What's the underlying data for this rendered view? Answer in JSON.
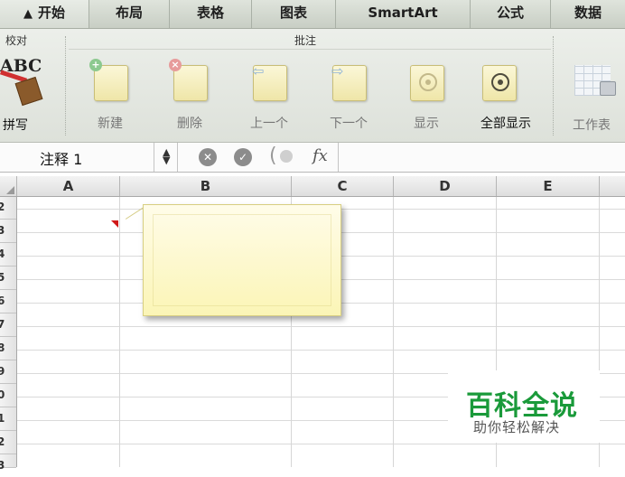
{
  "ribbon_tabs": [
    "开始",
    "布局",
    "表格",
    "图表",
    "SmartArt",
    "公式",
    "数据"
  ],
  "groups": {
    "proofing_title": "校对",
    "comments_title": "批注"
  },
  "spelling": {
    "icon_text": "ABC",
    "label": "拼写"
  },
  "comment_buttons": {
    "new": "新建",
    "delete": "删除",
    "previous": "上一个",
    "next": "下一个",
    "show": "显示",
    "show_all": "全部显示",
    "sheet": "工作表"
  },
  "formula_bar": {
    "name_box": "注释 1",
    "fx": "fx",
    "formula": ""
  },
  "columns": [
    "A",
    "B",
    "C",
    "D",
    "E"
  ],
  "rows": [
    "2",
    "3",
    "4",
    "5",
    "6",
    "7",
    "8",
    "9",
    "0",
    "1",
    "2",
    "3"
  ],
  "watermark": {
    "title": "百科全说",
    "subtitle": "助你轻松解决"
  },
  "colors": {
    "comment_fill": "#fbf5b6",
    "comment_indicator": "#d01818",
    "watermark_green": "#1a9a3a"
  }
}
